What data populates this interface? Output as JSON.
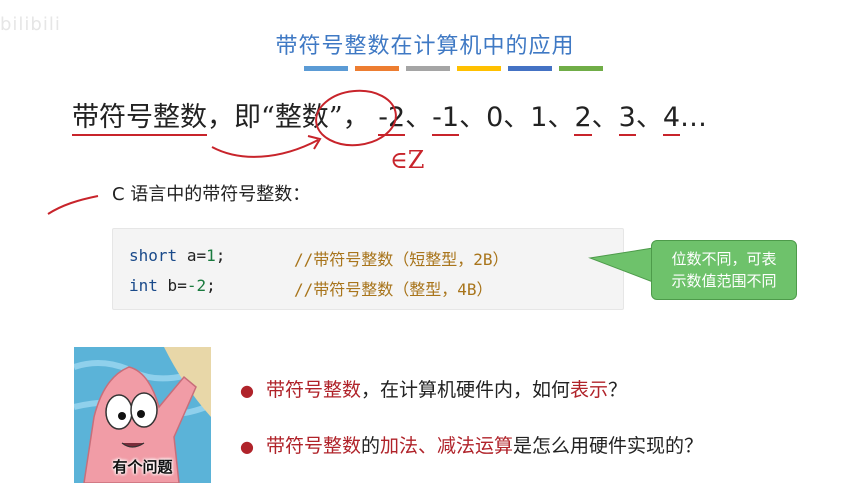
{
  "watermark": "bilibili",
  "title": "带符号整数在计算机中的应用",
  "accent_colors": [
    "#5b9bd5",
    "#ed7d31",
    "#a5a5a5",
    "#ffc000",
    "#4472c4",
    "#70ad47"
  ],
  "main_line": {
    "term": "带符号整数",
    "sep1": "，即“",
    "quoted": "整数",
    "sep2": "”，",
    "numbers": [
      "-2",
      "-1",
      "0",
      "1",
      "2",
      "3",
      "4"
    ],
    "ellipsis": "…",
    "delimiter": "、"
  },
  "handwritten_annotation": "∈Z",
  "subheading": "C 语言中的带符号整数：",
  "code": [
    {
      "type": "short",
      "var": "a",
      "op": "=",
      "val": "1",
      "end": ";",
      "comment": "//带符号整数（短整型，2B）"
    },
    {
      "type": "int",
      "var": "b",
      "op": "=",
      "val": "-2",
      "end": ";",
      "comment": "//带符号整数（整型，4B）"
    }
  ],
  "callout": {
    "line1": "位数不同，可表",
    "line2": "示数值范围不同"
  },
  "meme_caption": "有个问题",
  "bullets": [
    {
      "red1": "带符号整数",
      "text1": "，在计算机硬件内，如何",
      "red2": "表示",
      "text2": "？"
    },
    {
      "red1": "带符号整数",
      "text1": "的",
      "red2": "加法、减法运算",
      "text2": "是怎么用硬件实现的？"
    }
  ]
}
